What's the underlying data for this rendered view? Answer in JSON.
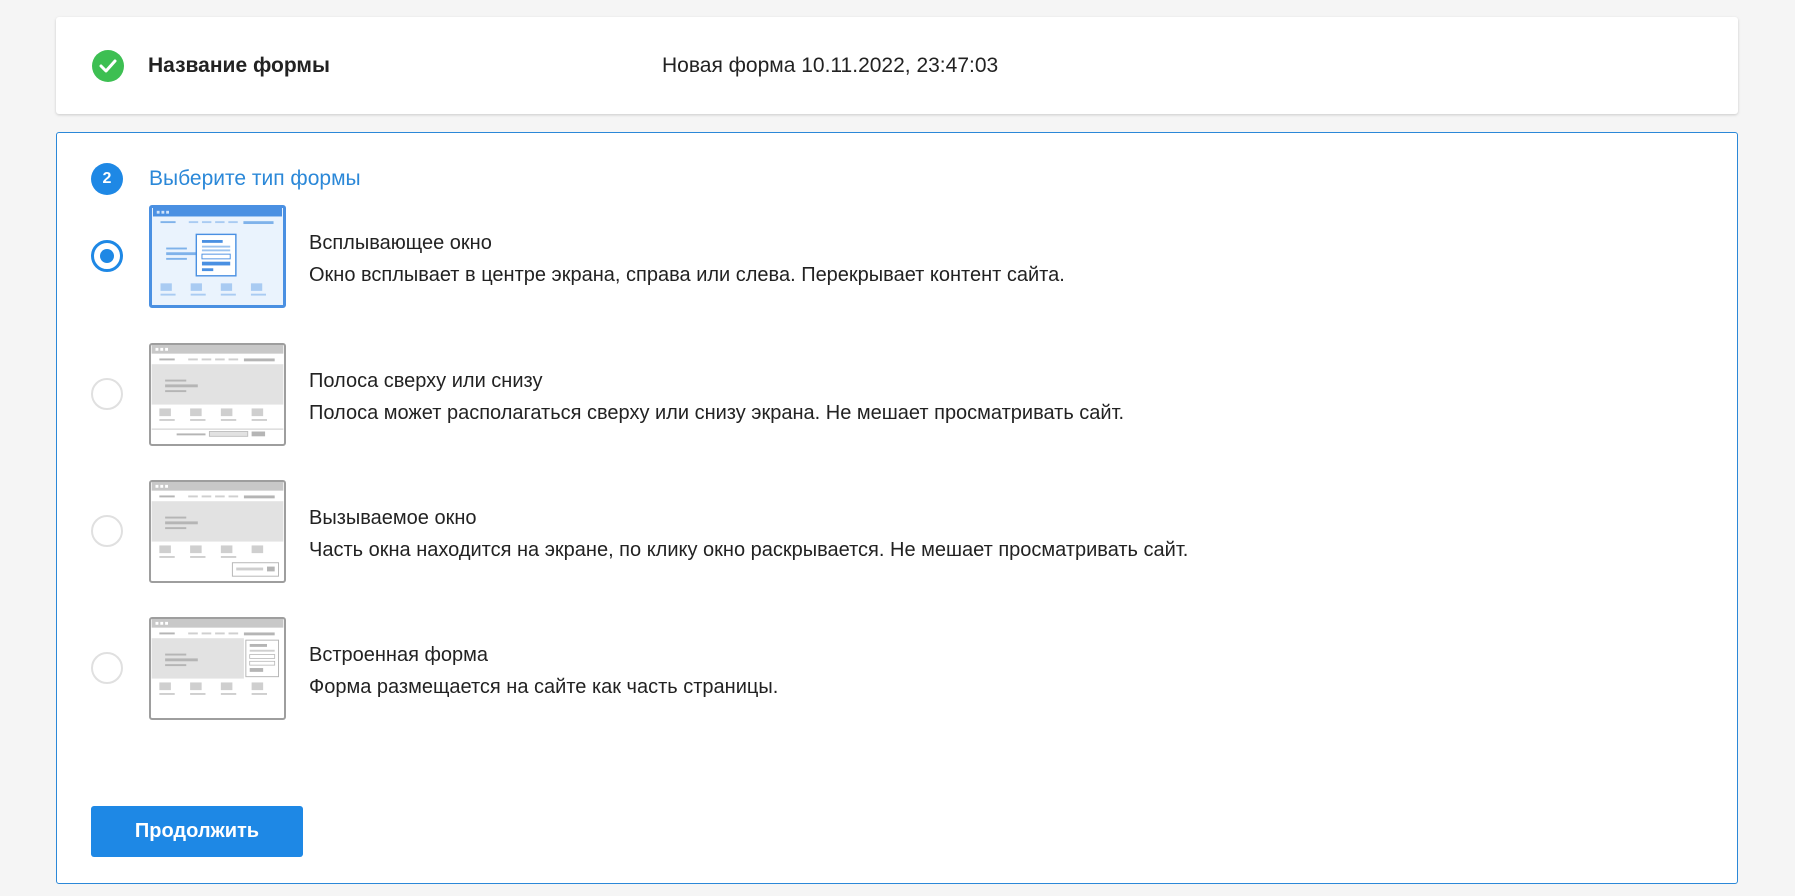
{
  "step1": {
    "label": "Название формы",
    "value": "Новая форма 10.11.2022, 23:47:03",
    "icon": "check-circle-icon"
  },
  "step2": {
    "number": "2",
    "title": "Выберите тип формы",
    "options": [
      {
        "title": "Всплывающее окно",
        "description": "Окно всплывает в центре экрана, справа или слева. Перекрывает контент сайта.",
        "selected": true
      },
      {
        "title": "Полоса сверху или снизу",
        "description": "Полоса может располагаться сверху или снизу экрана. Не мешает просматривать сайт.",
        "selected": false
      },
      {
        "title": "Вызываемое окно",
        "description": "Часть окна находится на экране, по клику окно раскрывается. Не мешает просматривать сайт.",
        "selected": false
      },
      {
        "title": "Встроенная форма",
        "description": "Форма размещается на сайте как часть страницы.",
        "selected": false
      }
    ],
    "continue_label": "Продолжить"
  },
  "colors": {
    "accent": "#1e88e5",
    "success": "#3dbf52",
    "border_active": "#2b88d8"
  }
}
